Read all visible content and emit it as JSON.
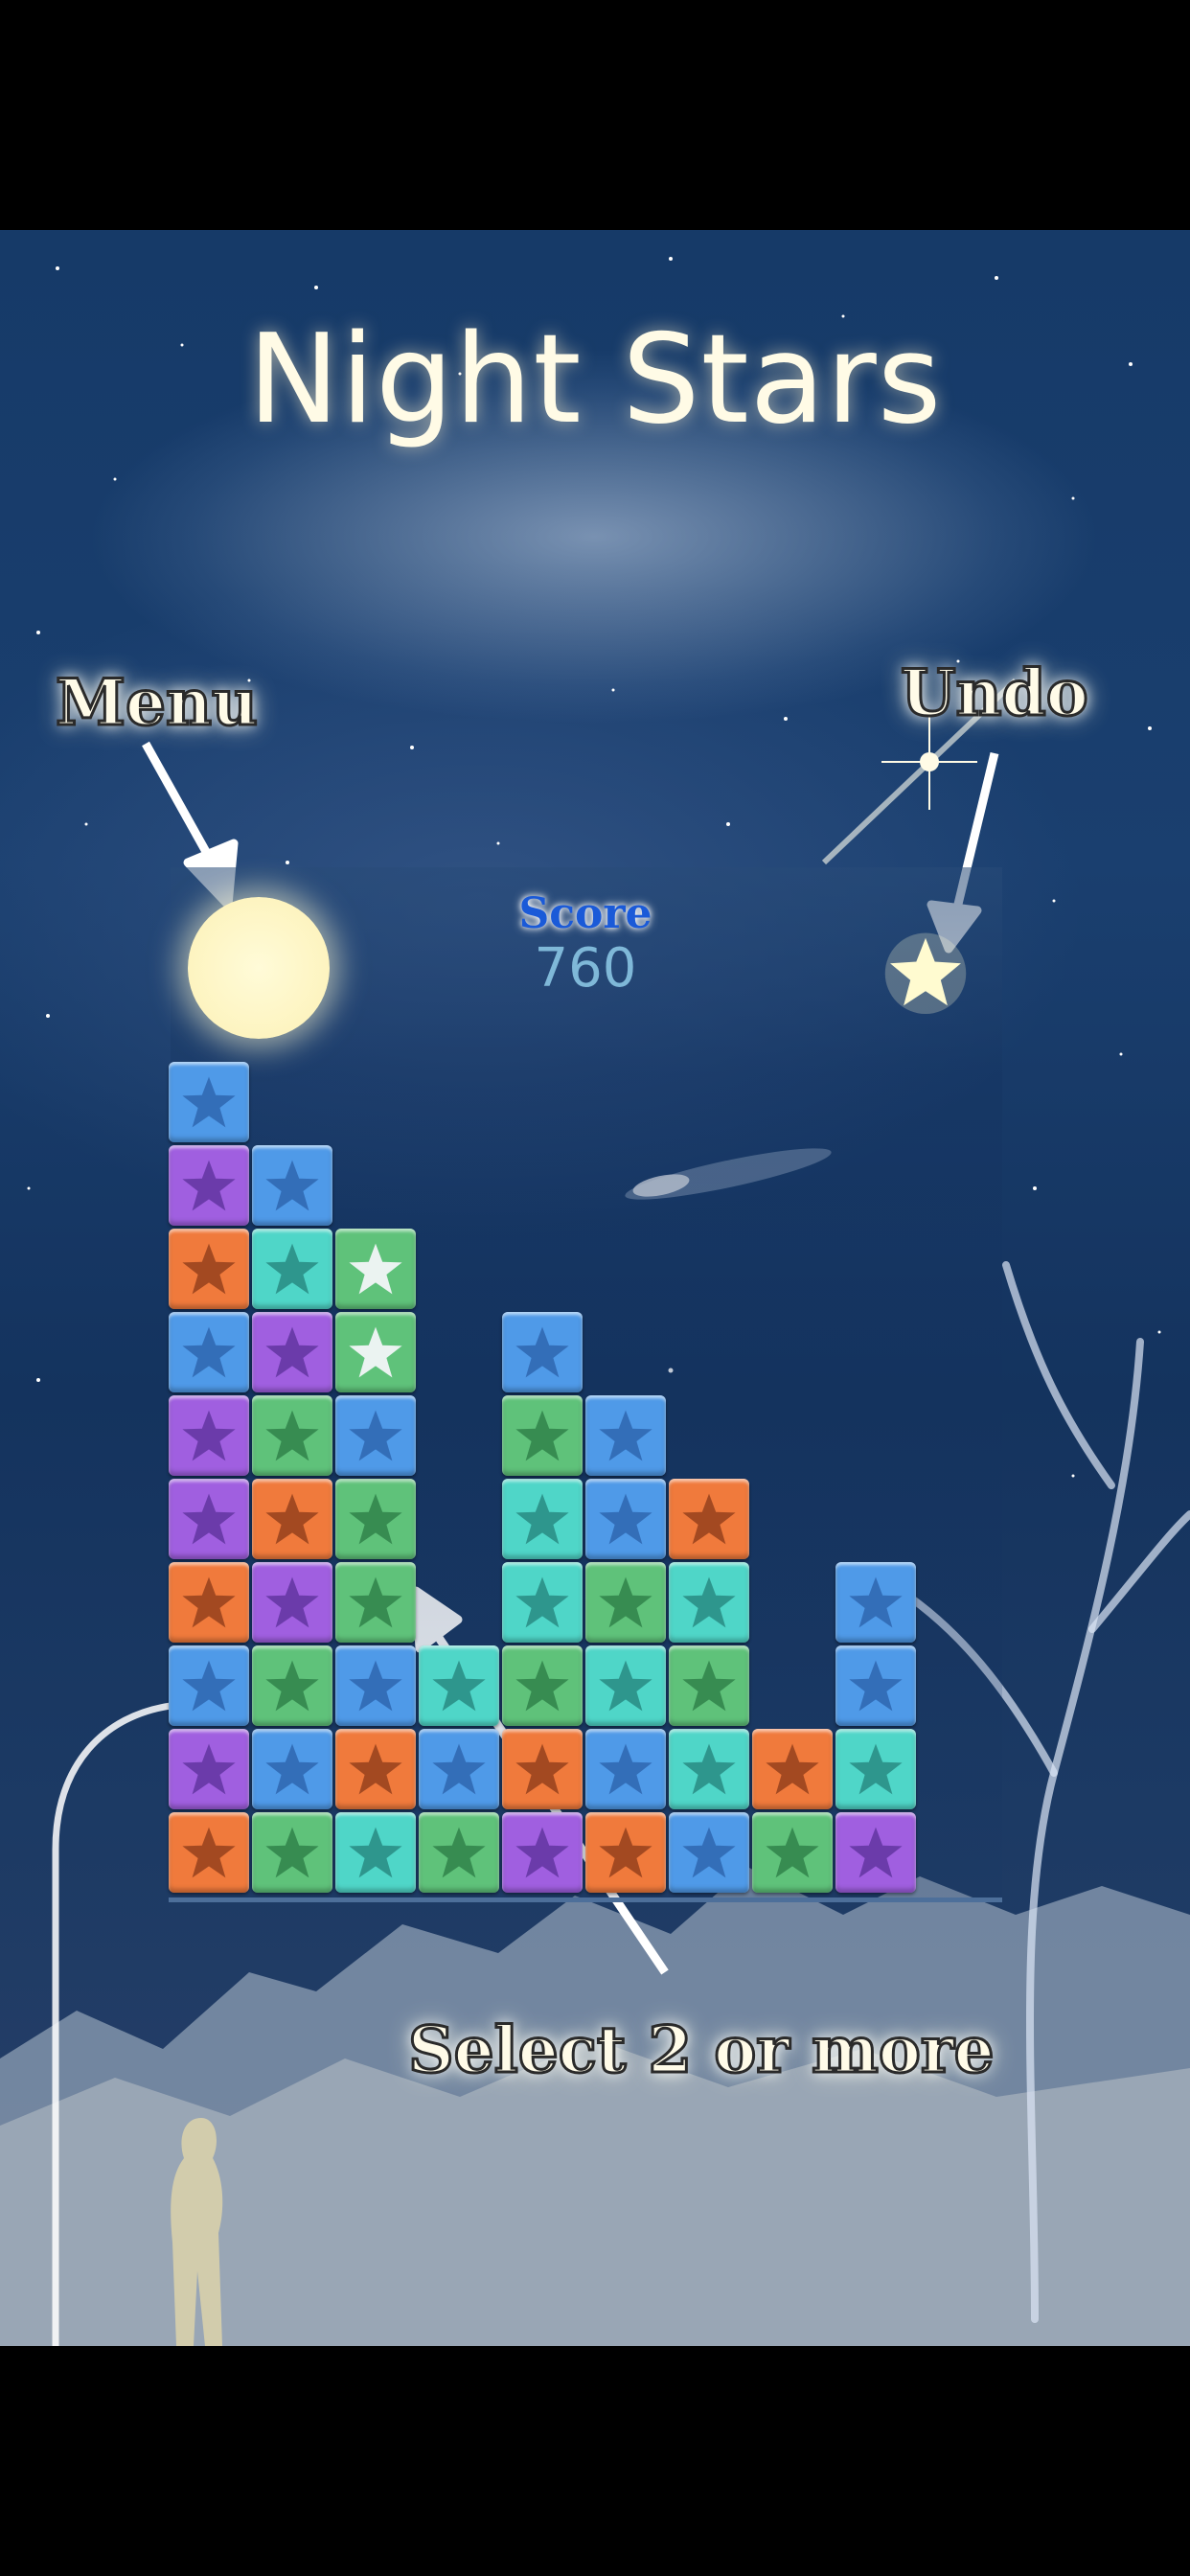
{
  "game": {
    "title": "Night Stars",
    "labels": {
      "menu": "Menu",
      "undo": "Undo",
      "select_hint": "Select 2 or more"
    },
    "score": {
      "label": "Score",
      "value": "760"
    },
    "colors": {
      "blue": "#4f9ae8",
      "purple": "#a05fe0",
      "orange": "#f07a3c",
      "teal": "#4fd6c8",
      "green": "#5fc27a"
    },
    "board": {
      "rows": 10,
      "cols": 9,
      "columns": [
        [
          "orange",
          "purple",
          "blue",
          "orange",
          "purple",
          "purple",
          "blue",
          "orange",
          "purple",
          "blue"
        ],
        [
          "green",
          "blue",
          "green",
          "purple",
          "orange",
          "green",
          "purple",
          "teal",
          "blue"
        ],
        [
          "teal",
          "orange",
          "blue",
          "green",
          "green",
          "blue",
          "green",
          "green"
        ],
        [
          "green",
          "blue",
          "teal"
        ],
        [
          "purple",
          "orange",
          "green",
          "teal",
          "teal",
          "green",
          "blue"
        ],
        [
          "orange",
          "blue",
          "teal",
          "green",
          "blue",
          "blue"
        ],
        [
          "blue",
          "teal",
          "green",
          "teal",
          "orange"
        ],
        [
          "green",
          "orange"
        ],
        [
          "purple",
          "teal",
          "blue",
          "blue"
        ]
      ],
      "highlighted": [
        [
          2,
          6
        ],
        [
          2,
          7
        ]
      ]
    }
  }
}
